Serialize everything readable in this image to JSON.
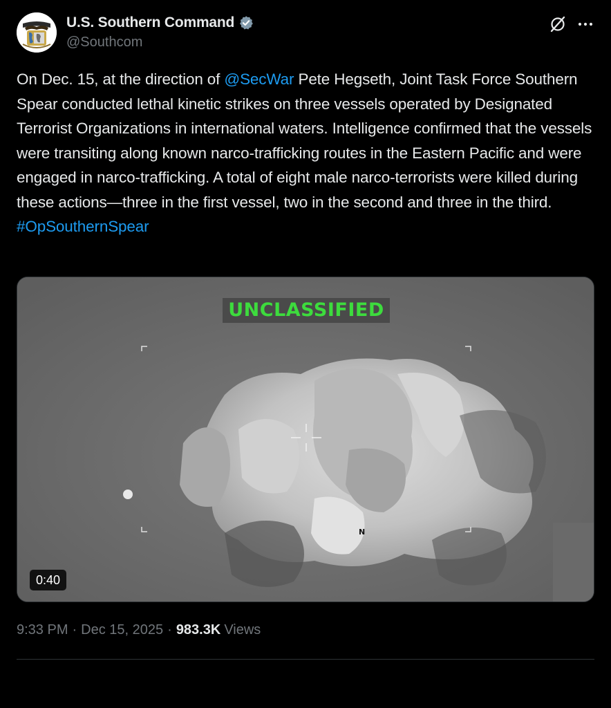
{
  "author": {
    "display_name": "U.S. Southern Command",
    "handle": "@Southcom",
    "verified_icon": "verified-badge-icon",
    "avatar_icon": "southcom-seal-logo"
  },
  "actions": {
    "grok_icon": "grok-icon",
    "more_icon": "more-horizontal-icon"
  },
  "tweet": {
    "text_1": "On Dec. 15, at the direction of ",
    "mention": "@SecWar",
    "text_2": " Pete Hegseth, Joint Task Force Southern Spear conducted lethal kinetic strikes on three vessels operated by Designated Terrorist Organizations in international waters. Intelligence confirmed that the vessels were transiting along known narco-trafficking routes in the Eastern Pacific and were engaged in narco-trafficking. A total of eight male narco-terrorists were killed during these actions—three in the first vessel, two in the second and three in the third. ",
    "hashtag": "#OpSouthernSpear"
  },
  "media": {
    "overlay_label": "UNCLASSIFIED",
    "compass_label": "N",
    "duration": "0:40"
  },
  "meta": {
    "time": "9:33 PM",
    "date": "Dec 15, 2025",
    "views_count": "983.3K",
    "views_label": "Views",
    "separator": "·"
  },
  "colors": {
    "background": "#000000",
    "text_primary": "#e7e9ea",
    "text_secondary": "#71767b",
    "link": "#1d9bf0",
    "overlay_green": "#3ddc3d"
  }
}
